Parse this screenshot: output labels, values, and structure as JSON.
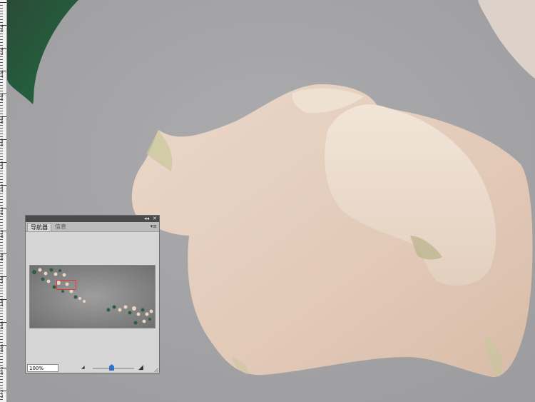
{
  "ruler": {
    "labels": [
      "4\n0",
      "4\n2",
      "4\n4",
      "4\n6",
      "4\n8",
      "5\n0",
      "5\n2",
      "5\n4",
      "5\n6",
      "5\n8",
      "6\n0",
      "6\n2",
      "6\n4",
      "6\n6",
      "6\n8",
      "7\n0",
      "7\n2"
    ]
  },
  "navigator": {
    "tab_active": "导航器",
    "tab_inactive": "信息",
    "collapse_label": "◂◂",
    "close_label": "✕",
    "menu_label": "▾≡",
    "zoom_value": "100%",
    "zoom_out_label": "◢",
    "zoom_in_label": "◢",
    "zoom_slider_level": 0.45
  },
  "colors": {
    "canvas_bg": "#a4a4a6",
    "petal": "#e8d6c6",
    "leaf": "#2f5a3f",
    "viewbox": "#e53939",
    "slider_thumb": "#2f73c9"
  }
}
